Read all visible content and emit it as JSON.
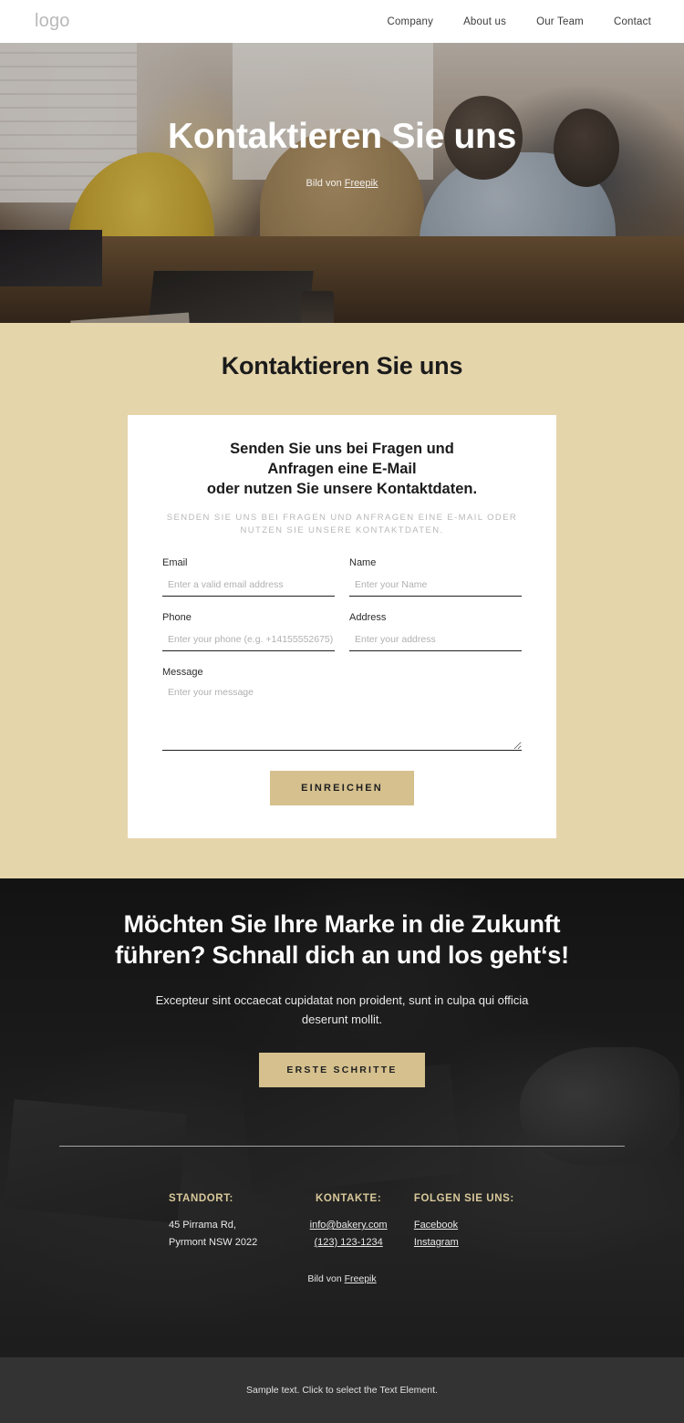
{
  "header": {
    "logo": "logo",
    "nav": [
      {
        "label": "Company"
      },
      {
        "label": "About us"
      },
      {
        "label": "Our Team"
      },
      {
        "label": "Contact"
      }
    ]
  },
  "hero": {
    "title": "Kontaktieren Sie uns",
    "credit_prefix": "Bild von ",
    "credit_link": "Freepik"
  },
  "contact": {
    "section_title": "Kontaktieren Sie uns",
    "form_heading_line1": "Senden Sie uns bei Fragen und",
    "form_heading_line2": "Anfragen eine E-Mail",
    "form_heading_line3": "oder nutzen Sie unsere Kontaktdaten.",
    "form_subheading": "Senden Sie uns bei Fragen und Anfragen eine E-Mail oder nutzen Sie unsere Kontaktdaten.",
    "fields": {
      "email": {
        "label": "Email",
        "placeholder": "Enter a valid email address",
        "value": ""
      },
      "name": {
        "label": "Name",
        "placeholder": "Enter your Name",
        "value": ""
      },
      "phone": {
        "label": "Phone",
        "placeholder": "Enter your phone (e.g. +14155552675)",
        "value": ""
      },
      "address": {
        "label": "Address",
        "placeholder": "Enter your address",
        "value": ""
      },
      "message": {
        "label": "Message",
        "placeholder": "Enter your message",
        "value": ""
      }
    },
    "submit_label": "EINREICHEN"
  },
  "cta": {
    "title_line1": "Möchten Sie Ihre Marke in die",
    "title_line2": "Zukunft führen? Schnall dich an",
    "title_line3": "und los geht‘s!",
    "text_line1": "Excepteur sint occaecat cupidatat non proident, sunt in",
    "text_line2": "culpa qui officia deserunt mollit.",
    "button_label": "ERSTE SCHRITTE"
  },
  "footer": {
    "columns": [
      {
        "heading": "STANDORT:",
        "lines": [
          "45 Pirrama Rd,",
          "Pyrmont NSW 2022"
        ],
        "links": []
      },
      {
        "heading": "KONTAKTE:",
        "lines": [],
        "links": [
          "info@bakery.com",
          "(123) 123-1234"
        ]
      },
      {
        "heading": "FOLGEN SIE UNS:",
        "lines": [],
        "links": [
          "Facebook",
          "Instagram"
        ]
      }
    ],
    "credit_prefix": "Bild von ",
    "credit_link": "Freepik"
  },
  "bottom_bar": {
    "text": "Sample text. Click to select the Text Element."
  },
  "colors": {
    "tan_background": "#e5d5ab",
    "accent_button": "#d5c08e",
    "footer_heading": "#d8c89a",
    "bottom_bar": "#333333"
  }
}
